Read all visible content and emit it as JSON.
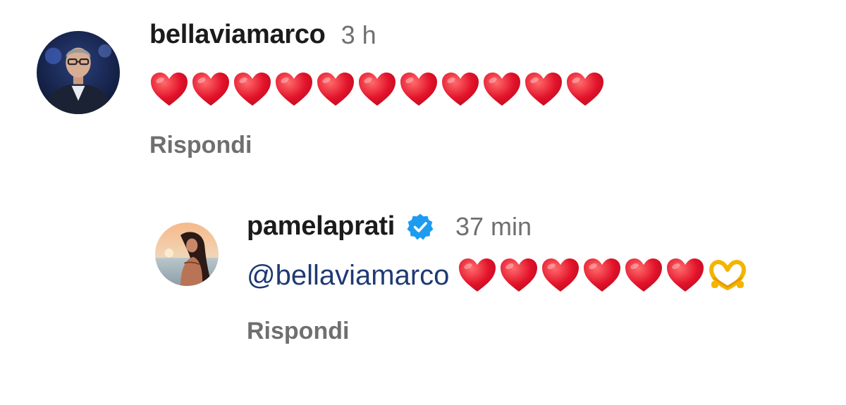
{
  "comments": [
    {
      "username": "bellaviamarco",
      "time": "3 h",
      "heart_count": 11,
      "reply_label": "Rispondi",
      "avatar_icon": "person-in-suit-avatar"
    }
  ],
  "reply": {
    "username": "pamelaprati",
    "verified": true,
    "verified_icon": "verified-badge-icon",
    "time": "37 min",
    "mention": "@bellaviamarco",
    "heart_count": 6,
    "trailing_emoji": "heart-hands-emoji",
    "reply_label": "Rispondi",
    "avatar_icon": "woman-beach-sunset-avatar"
  },
  "colors": {
    "heart": "#e2122a",
    "verified": "#1d9bf0",
    "mention": "#1f3a73",
    "muted": "#6f6f6f"
  }
}
